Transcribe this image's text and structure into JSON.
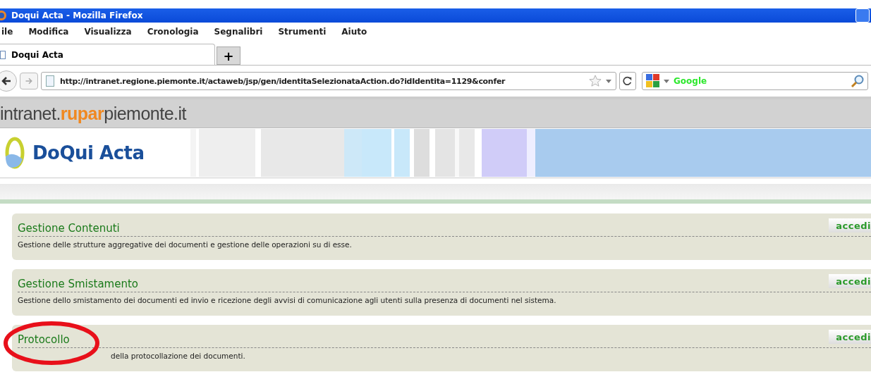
{
  "window": {
    "title": "Doqui Acta - Mozilla Firefox"
  },
  "menu": [
    "ile",
    "Modifica",
    "Visualizza",
    "Cronologia",
    "Segnalibri",
    "Strumenti",
    "Aiuto"
  ],
  "tabs": [
    {
      "label": "Doqui Acta",
      "selected": true
    },
    {
      "label": "+",
      "selected": false
    }
  ],
  "address": {
    "value": "http://intranet.regione.piemonte.it/actaweb/jsp/gen/identitaSelezionataAction.do?idIdentita=1129&confer"
  },
  "search": {
    "placeholder": "Google"
  },
  "portal": {
    "prefix": "intranet.",
    "highlight": "rupar",
    "suffix": "piemonte.it"
  },
  "app": {
    "title": "DoQui Acta"
  },
  "cards": [
    {
      "title": "Gestione Contenuti",
      "button": "accedi",
      "description": "Gestione delle strutture aggregative dei documenti e gestione delle operazioni su di esse.",
      "circled": false
    },
    {
      "title": "Gestione Smistamento",
      "button": "accedi",
      "description": "Gestione dello smistamento dei documenti ed invio e ricezione degli avvisi di comunicazione agli utenti sulla presenza di documenti nel sistema.",
      "circled": false
    },
    {
      "title": "Protocollo",
      "button": "accedi",
      "description": "della protocollazione dei documenti.",
      "circled": true
    }
  ]
}
